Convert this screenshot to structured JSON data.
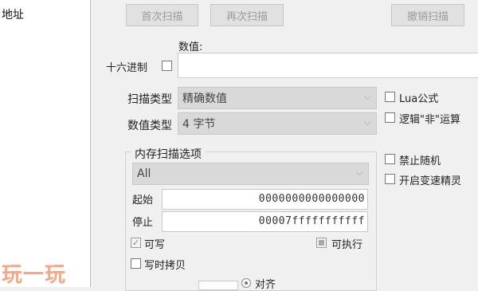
{
  "address_list": {
    "header": "地址"
  },
  "scan_buttons": {
    "first_scan": "首次扫描",
    "next_scan": "再次扫描",
    "undo_scan": "撤销扫描"
  },
  "value_field": {
    "label": "数值:",
    "value": ""
  },
  "hex_checkbox": {
    "label": "十六进制",
    "checked": false
  },
  "scan_type": {
    "label": "扫描类型",
    "selected": "精确数值"
  },
  "value_type": {
    "label": "数值类型",
    "selected": "4 字节"
  },
  "options_right": {
    "lua_formula": "Lua公式",
    "logic_not": "逻辑\"非\"运算",
    "disable_random": "禁止随机",
    "speedhack": "开启变速精灵"
  },
  "memory_options": {
    "title": "内存扫描选项",
    "region": "All",
    "start_label": "起始",
    "start_value": "0000000000000000",
    "stop_label": "停止",
    "stop_value": "00007fffffffffff",
    "writable_label": "可写",
    "writable_checked": true,
    "executable_label": "可执行",
    "copy_on_write_label": "写时拷贝",
    "align_label": "对齐"
  },
  "watermark": "玩一玩"
}
